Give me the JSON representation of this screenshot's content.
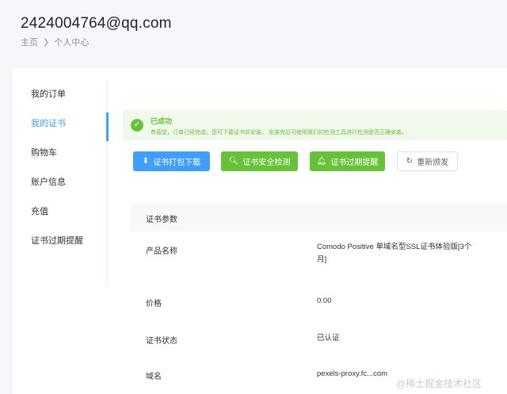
{
  "header": {
    "title": "2424004764@qq.com",
    "breadcrumb": [
      "主页",
      "个人中心"
    ]
  },
  "sidebar": {
    "items": [
      {
        "label": "我的订单",
        "active": false
      },
      {
        "label": "我的证书",
        "active": true
      },
      {
        "label": "购物车",
        "active": false
      },
      {
        "label": "账户信息",
        "active": false
      },
      {
        "label": "充值",
        "active": false
      },
      {
        "label": "证书过期提醒",
        "active": false
      }
    ]
  },
  "alert": {
    "title": "已成功",
    "desc": "恭喜您，订单已经完成，您可下载证书并安装。 安装完后可使用我们的检测工具进行检测是否正确安装。",
    "color": "#67c23a"
  },
  "actions": {
    "download": "证书打包下载",
    "security_check": "证书安全检测",
    "expiry_remind": "证书过期提醒",
    "reissue": "重新颁发"
  },
  "params": {
    "header": "证书参数",
    "rows": [
      {
        "label": "产品名称",
        "value": "Comodo Positive 单域名型SSL证书体验版[3个月]"
      },
      {
        "label": "价格",
        "value": "0.00"
      },
      {
        "label": "证书状态",
        "value": "已认证"
      },
      {
        "label": "域名",
        "value": "pexels-proxy.fc...com"
      }
    ]
  },
  "watermark": "@稀土掘金技术社区",
  "colors": {
    "accent": "#409eff",
    "success": "#67c23a"
  }
}
